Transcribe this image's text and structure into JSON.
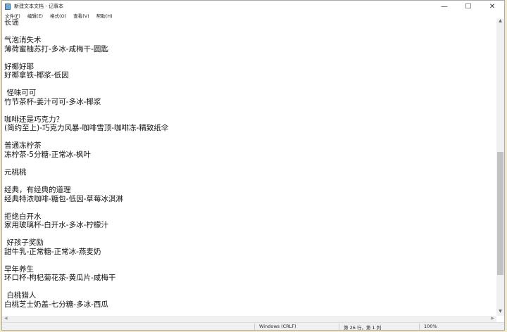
{
  "window": {
    "title": "新建文本文档 - 记事本",
    "minimize": "—",
    "maximize": "☐",
    "close": "✕"
  },
  "menu": [
    "文件(F)",
    "编辑(E)",
    "格式(O)",
    "查看(V)",
    "帮助(H)"
  ],
  "content": "长谣\n\n气泡消失术\n薄荷蜜柚苏打-多冰-咸梅干-圆匙\n\n好椰好耶\n好椰拿铁-椰浆-低因\n\n 怪味可可\n竹节茶杯-姜汁可可-多冰-椰浆\n\n咖啡还是巧克力？\n(简约至上)-巧克力风暴-咖啡雪顶-咖啡冻-精致纸伞\n\n普通冻柠茶\n冻柠茶-5分糖-正常冰-枫叶\n\n元桃桃\n\n经典，有经典的道理\n经典特浓咖啡-糖包-低因-草莓冰淇淋\n\n拒绝白开水\n家用玻璃杯-白开水-多冰-柠檬汁\n\n 好孩子奖励\n甜牛乳-正常糖-正常冰-燕麦奶\n\n早年养生\n环口杯-枸杞菊花茶-黄瓜片-咸梅干\n\n 白桃猎人\n白桃芝士奶盖-七分糖-多冰-西瓜",
  "status": {
    "encoding": "Windows (CRLF)",
    "position": "第 26 行，第 1 列",
    "zoom": "100%"
  }
}
